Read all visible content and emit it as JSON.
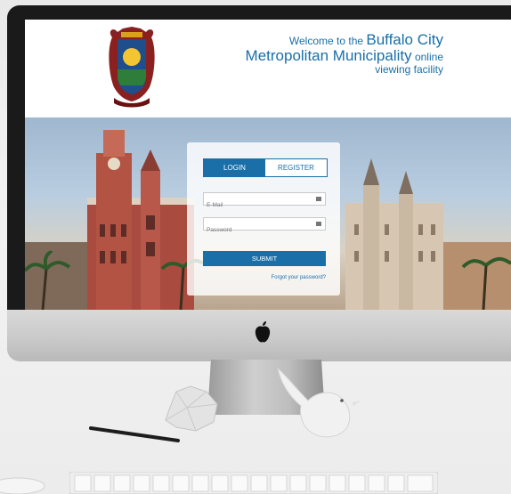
{
  "site": {
    "welcome_prefix": "Welcome to the ",
    "city_name_1": "Buffalo City",
    "city_name_2": "Metropolitan Municipality",
    "online_word": " online",
    "line3": "viewing facility"
  },
  "login": {
    "tabs": [
      {
        "label": "LOGIN",
        "active": true
      },
      {
        "label": "REGISTER",
        "active": false
      }
    ],
    "email_placeholder": "E-Mail",
    "password_placeholder": "Password",
    "submit_label": "SUBMIT",
    "forgot_link": "Forgot your password?"
  },
  "colors": {
    "accent": "#1a6fa8",
    "monitor_bezel": "#1a1a1a",
    "page_background": "#ececec"
  },
  "icons": [
    "crest-logo",
    "email-field-icon",
    "password-field-icon",
    "apple-logo-icon"
  ]
}
